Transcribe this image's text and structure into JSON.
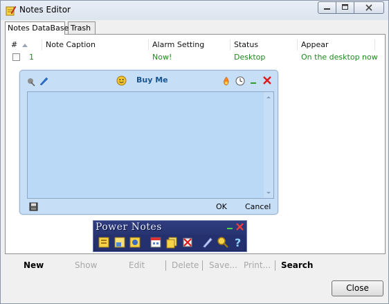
{
  "window": {
    "title": "Notes Editor",
    "icon": "notepad-pencil-icon"
  },
  "tabs": [
    {
      "label": "Notes DataBase",
      "active": true
    },
    {
      "label": "Trash",
      "active": false
    }
  ],
  "list": {
    "columns": [
      "#",
      "Note Caption",
      "Alarm Setting",
      "Status",
      "Appear"
    ],
    "rows": [
      {
        "num": "1",
        "caption": "",
        "alarm": "Now!",
        "status": "Desktop",
        "appear": "On the desktop now"
      }
    ]
  },
  "note": {
    "caption": "Buy Me",
    "ok_label": "OK",
    "cancel_label": "Cancel"
  },
  "power_notes": {
    "title": "Power Notes"
  },
  "toolbar": {
    "new": "New",
    "show": "Show",
    "edit": "Edit",
    "delete": "Delete",
    "save": "Save...",
    "print": "Print...",
    "search": "Search"
  },
  "close_label": "Close",
  "colors": {
    "note_background": "#c7def7",
    "status_text": "#1d8a1d",
    "note_caption": "#17548f",
    "power_notes_bar": "#2f3d7f"
  }
}
